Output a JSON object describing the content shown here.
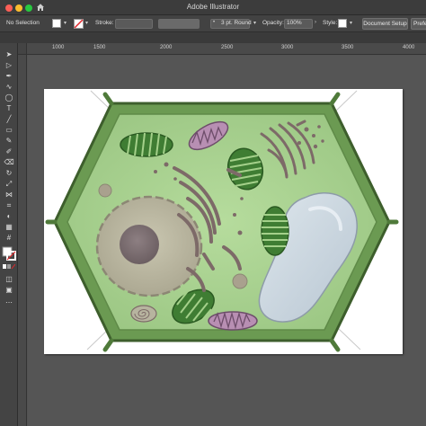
{
  "window": {
    "title": "Adobe Illustrator",
    "home_icon": "home-icon"
  },
  "control_bar": {
    "selection_label": "No Selection",
    "stroke_label": "Stroke:",
    "brush_value": "3 pt. Round",
    "opacity_label": "Opacity:",
    "opacity_value": "100%",
    "style_label": "Style:",
    "document_setup_label": "Document Setup",
    "preferences_label": "Prefe"
  },
  "rulers": {
    "labels": [
      "1000",
      "1500",
      "2000",
      "2500",
      "3000",
      "3500",
      "4000"
    ]
  },
  "tools": [
    {
      "name": "selection-tool-icon",
      "glyph": "➤"
    },
    {
      "name": "direct-selection-tool-icon",
      "glyph": "▷"
    },
    {
      "name": "pen-tool-icon",
      "glyph": "✒"
    },
    {
      "name": "curvature-tool-icon",
      "glyph": "∿"
    },
    {
      "name": "ellipse-tool-icon",
      "glyph": "◯"
    },
    {
      "name": "type-tool-icon",
      "glyph": "T"
    },
    {
      "name": "line-tool-icon",
      "glyph": "╱"
    },
    {
      "name": "rectangle-tool-icon",
      "glyph": "▭"
    },
    {
      "name": "paintbrush-tool-icon",
      "glyph": "✎"
    },
    {
      "name": "shaper-tool-icon",
      "glyph": "✐"
    },
    {
      "name": "eraser-tool-icon",
      "glyph": "⌫"
    },
    {
      "name": "rotate-tool-icon",
      "glyph": "↻"
    },
    {
      "name": "scale-tool-icon",
      "glyph": "⤢"
    },
    {
      "name": "width-tool-icon",
      "glyph": "⋈"
    },
    {
      "name": "free-transform-tool-icon",
      "glyph": "⌗"
    },
    {
      "name": "shape-builder-tool-icon",
      "glyph": "◐"
    },
    {
      "name": "perspective-grid-tool-icon",
      "glyph": "▦"
    },
    {
      "name": "mesh-tool-icon",
      "glyph": "#"
    },
    {
      "name": "gradient-tool-icon",
      "glyph": "▤"
    },
    {
      "name": "eyedropper-tool-icon",
      "glyph": "⚲"
    },
    {
      "name": "blend-tool-icon",
      "glyph": "∞"
    },
    {
      "name": "symbol-sprayer-tool-icon",
      "glyph": "✺"
    },
    {
      "name": "column-graph-tool-icon",
      "glyph": "▥"
    },
    {
      "name": "artboard-tool-icon",
      "glyph": "⊡"
    },
    {
      "name": "slice-tool-icon",
      "glyph": "✂"
    },
    {
      "name": "hand-tool-icon",
      "glyph": "✋"
    },
    {
      "name": "zoom-tool-icon",
      "glyph": "⌕"
    }
  ],
  "colors": {
    "cell_wall": "#4f7a3a",
    "cytoplasm": "#a6d08d",
    "nucleus": "#b7b49f",
    "nucleolus": "#7d6f72",
    "chloroplast": "#3f7d33",
    "mitochondria": "#b88fb3",
    "vacuole": "#c8d4de",
    "er_golgi": "#7d6a68"
  }
}
